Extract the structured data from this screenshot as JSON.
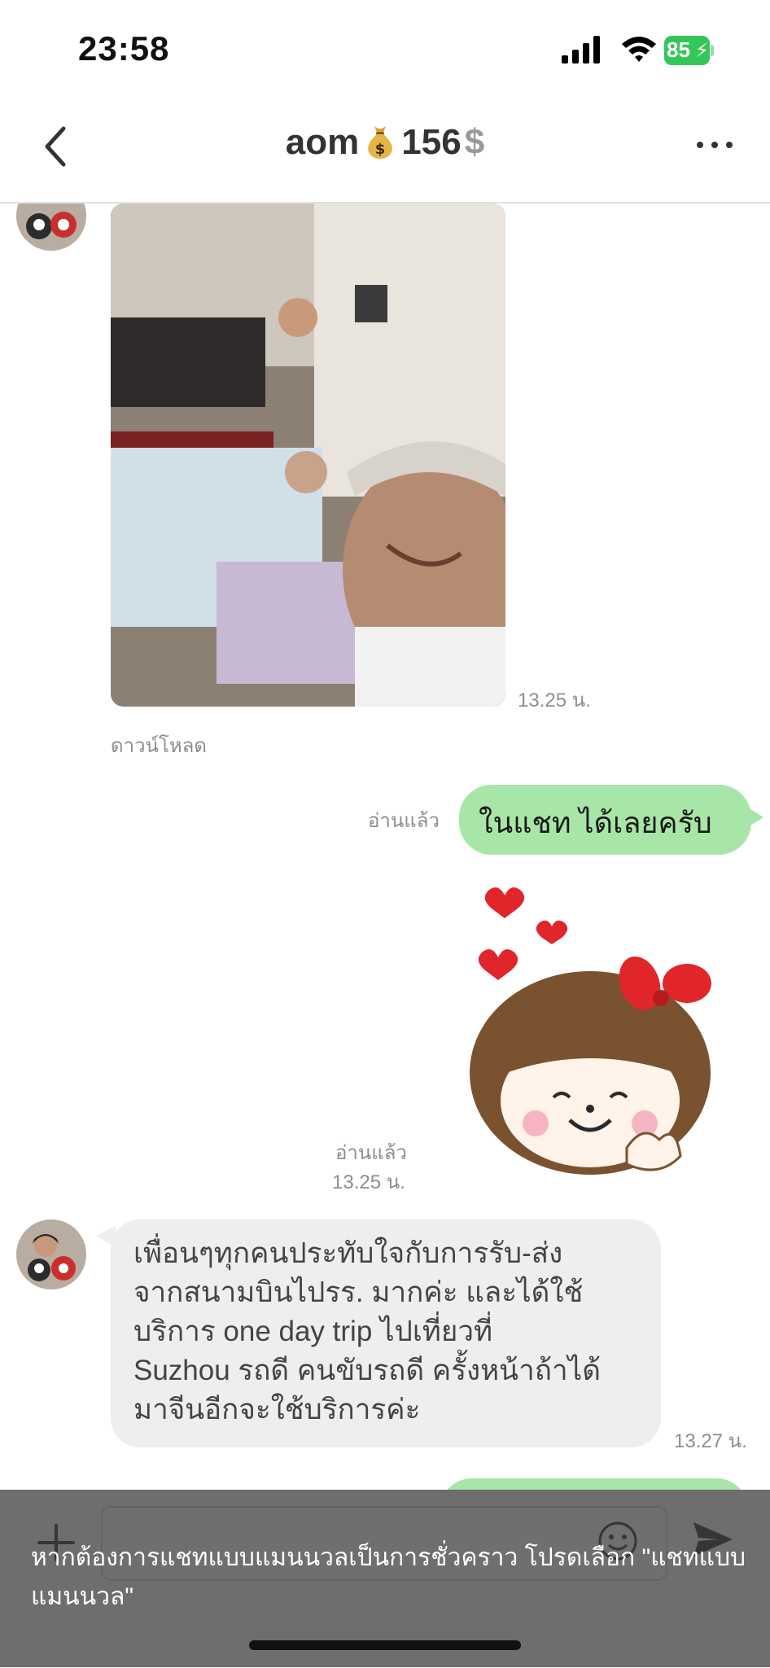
{
  "status_bar": {
    "time": "23:58",
    "battery": "85"
  },
  "header": {
    "name": "aom",
    "number": "156",
    "currency": "$"
  },
  "messages": {
    "photo_time": "13.25 น.",
    "download": "ดาวน์โหลด",
    "out_read": "อ่านแล้ว",
    "out_text": "ในแชท ได้เลยครับ",
    "sticker_read": "อ่านแล้ว",
    "sticker_time": "13.25 น.",
    "in_lines": [
      "เพื่อนๆทุกคนประทับใจกับการรับ-ส่ง",
      "จากสนามบินไปรร. มากค่ะ และได้ใช้",
      "บริการ one day trip ไปเที่ยวที่",
      "Suzhou รถดี คนขับรถดี ครั้งหน้าถ้าได้",
      "มาจีนอีกจะใช้บริการค่ะ"
    ],
    "in_time": "13.27 น."
  },
  "toast": {
    "line1": "หากต้องการแชทแบบแมนนวลเป็นการชั่วคราว โปรดเลือก \"แชทแบบ",
    "line2": "แมนนวล\""
  },
  "colors": {
    "outgoing_bubble": "#a8e6a8",
    "incoming_bubble": "#eeeeee",
    "battery": "#33c759"
  },
  "icons": [
    "back-icon",
    "money-bag-icon",
    "more-icon",
    "plus-icon",
    "emoji-icon",
    "send-icon"
  ]
}
